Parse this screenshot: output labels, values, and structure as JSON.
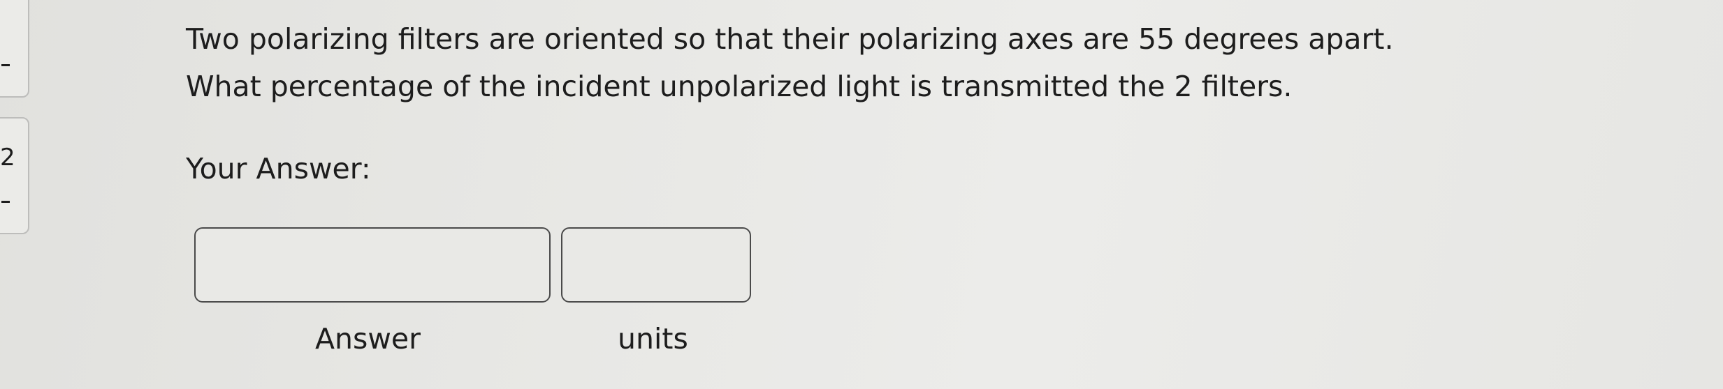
{
  "sidebar": {
    "items": [
      {
        "number": "",
        "dash": "-"
      },
      {
        "number": "2",
        "dash": "-"
      }
    ]
  },
  "question": {
    "line1": "Two polarizing filters are oriented so that their polarizing axes are 55 degrees apart.",
    "line2": "What percentage of the incident unpolarized light is transmitted the 2 filters."
  },
  "answer_heading": "Your Answer:",
  "answer_field": {
    "value": "",
    "placeholder": "",
    "label": "Answer"
  },
  "units_field": {
    "value": "",
    "placeholder": "",
    "label": "units"
  }
}
